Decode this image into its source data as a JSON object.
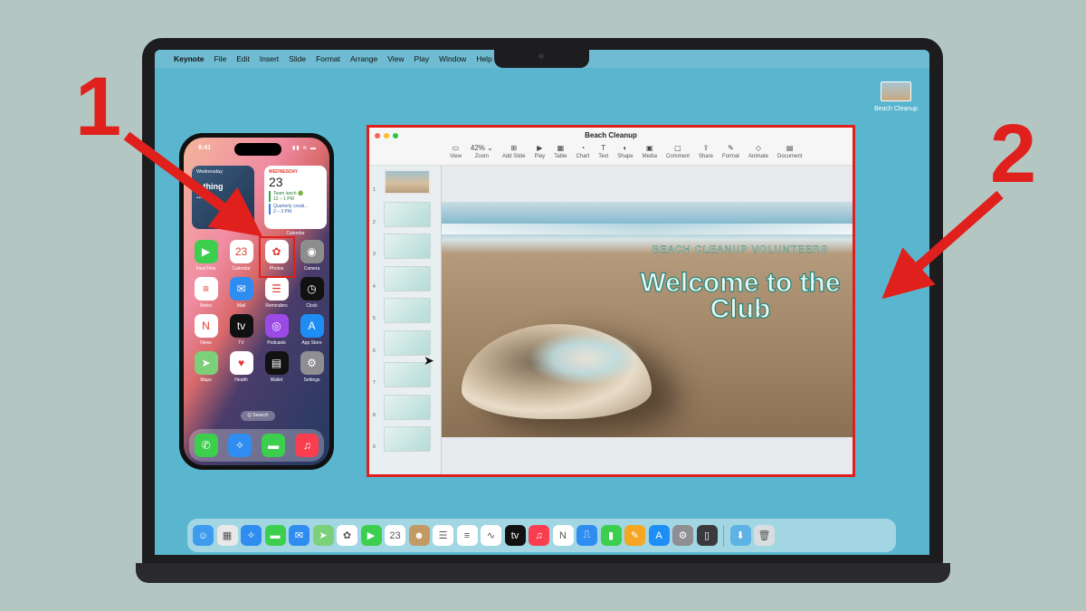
{
  "menubar": {
    "apple": "",
    "app_name": "Keynote",
    "items": [
      "File",
      "Edit",
      "Insert",
      "Slide",
      "Format",
      "Arrange",
      "View",
      "Play",
      "Window",
      "Help"
    ]
  },
  "desktop_file": {
    "label": "Beach Cleanup"
  },
  "iphone": {
    "time": "9:41",
    "status": "▮▮ ≋ ▬",
    "photo_widget": {
      "day": "Wednesday",
      "text": "...thing\n...t..."
    },
    "calendar_widget": {
      "month": "WEDNESDAY",
      "day": "23",
      "events": [
        {
          "title": "Team lunch 🟢",
          "time": "12 – 1 PM"
        },
        {
          "title": "Quarterly creati...",
          "time": "2 – 3 PM"
        }
      ],
      "label": "Calendar"
    },
    "apps": [
      {
        "label": "FaceTime",
        "icon": "facetime-icon",
        "color": "#3ccf4e",
        "glyph": "▶"
      },
      {
        "label": "Calendar",
        "icon": "calendar-icon",
        "color": "#ffffff",
        "glyph": "23"
      },
      {
        "label": "Photos",
        "icon": "photos-icon",
        "color": "#ffffff",
        "glyph": "✿"
      },
      {
        "label": "Camera",
        "icon": "camera-icon",
        "color": "#8d8d8d",
        "glyph": "◉"
      },
      {
        "label": "Notes",
        "icon": "notes-icon",
        "color": "#ffffff",
        "glyph": "≡"
      },
      {
        "label": "Mail",
        "icon": "mail-icon",
        "color": "#2f8cf0",
        "glyph": "✉"
      },
      {
        "label": "Reminders",
        "icon": "reminders-icon",
        "color": "#ffffff",
        "glyph": "☰"
      },
      {
        "label": "Clock",
        "icon": "clock-icon",
        "color": "#111111",
        "glyph": "◷"
      },
      {
        "label": "News",
        "icon": "news-icon",
        "color": "#ffffff",
        "glyph": "N"
      },
      {
        "label": "TV",
        "icon": "tv-icon",
        "color": "#111111",
        "glyph": "tv"
      },
      {
        "label": "Podcasts",
        "icon": "podcasts-icon",
        "color": "#9b4ae6",
        "glyph": "◎"
      },
      {
        "label": "App Store",
        "icon": "app-store-icon",
        "color": "#1e8ef5",
        "glyph": "A"
      },
      {
        "label": "Maps",
        "icon": "maps-icon",
        "color": "#7dd07a",
        "glyph": "➤"
      },
      {
        "label": "Health",
        "icon": "health-icon",
        "color": "#ffffff",
        "glyph": "♥"
      },
      {
        "label": "Wallet",
        "icon": "wallet-icon",
        "color": "#111111",
        "glyph": "▤"
      },
      {
        "label": "Settings",
        "icon": "settings-icon",
        "color": "#8e8e93",
        "glyph": "⚙"
      }
    ],
    "search": "Q Search",
    "dock": [
      {
        "icon": "phone-icon",
        "color": "#3ccf4e",
        "glyph": "✆"
      },
      {
        "icon": "safari-icon",
        "color": "#2f8cf0",
        "glyph": "✧"
      },
      {
        "icon": "messages-icon",
        "color": "#3ccf4e",
        "glyph": "▬"
      },
      {
        "icon": "music-icon",
        "color": "#fa3d4f",
        "glyph": "♫"
      }
    ]
  },
  "keynote": {
    "title": "Beach Cleanup",
    "toolbar": [
      {
        "label": "View",
        "icon": "view-icon",
        "glyph": "▭"
      },
      {
        "label": "Zoom",
        "icon": "zoom-icon",
        "glyph": "42% ⌄"
      },
      {
        "label": "Add Slide",
        "icon": "add-slide-icon",
        "glyph": "⊞"
      },
      {
        "label": "Play",
        "icon": "play-icon",
        "glyph": "▶"
      },
      {
        "label": "Table",
        "icon": "table-icon",
        "glyph": "▦"
      },
      {
        "label": "Chart",
        "icon": "chart-icon",
        "glyph": "◔"
      },
      {
        "label": "Text",
        "icon": "text-icon",
        "glyph": "T"
      },
      {
        "label": "Shape",
        "icon": "shape-icon",
        "glyph": "◐"
      },
      {
        "label": "Media",
        "icon": "media-icon",
        "glyph": "▣"
      },
      {
        "label": "Comment",
        "icon": "comment-icon",
        "glyph": "▢"
      },
      {
        "label": "Share",
        "icon": "share-icon",
        "glyph": "⇪"
      },
      {
        "label": "Format",
        "icon": "format-icon",
        "glyph": "✎"
      },
      {
        "label": "Animate",
        "icon": "animate-icon",
        "glyph": "◇"
      },
      {
        "label": "Document",
        "icon": "document-icon",
        "glyph": "▤"
      }
    ],
    "slide_numbers": [
      "1",
      "2",
      "3",
      "4",
      "5",
      "6",
      "7",
      "8",
      "9"
    ],
    "slide": {
      "kicker": "BEACH CLEANUP VOLUNTEERS",
      "title": "Welcome to the Club"
    }
  },
  "annotations": {
    "one": "1",
    "two": "2"
  },
  "colors": {
    "annotation_red": "#e0201c",
    "desktop": "#5ab6cf"
  },
  "mac_dock": [
    {
      "icon": "finder-icon",
      "color": "#3d9cf0",
      "glyph": "☺"
    },
    {
      "icon": "launchpad-icon",
      "color": "#e8e8e8",
      "glyph": "▦"
    },
    {
      "icon": "safari-icon",
      "color": "#2f8cf0",
      "glyph": "✧"
    },
    {
      "icon": "messages-icon",
      "color": "#3ccf4e",
      "glyph": "▬"
    },
    {
      "icon": "mail-icon",
      "color": "#2f8cf0",
      "glyph": "✉"
    },
    {
      "icon": "maps-icon",
      "color": "#7dd07a",
      "glyph": "➤"
    },
    {
      "icon": "photos-icon",
      "color": "#ffffff",
      "glyph": "✿"
    },
    {
      "icon": "facetime-icon",
      "color": "#3ccf4e",
      "glyph": "▶"
    },
    {
      "icon": "calendar-icon",
      "color": "#ffffff",
      "glyph": "23"
    },
    {
      "icon": "contacts-icon",
      "color": "#c29a64",
      "glyph": "☻"
    },
    {
      "icon": "reminders-icon",
      "color": "#ffffff",
      "glyph": "☰"
    },
    {
      "icon": "notes-icon",
      "color": "#ffffff",
      "glyph": "≡"
    },
    {
      "icon": "freeform-icon",
      "color": "#ffffff",
      "glyph": "∿"
    },
    {
      "icon": "tv-icon",
      "color": "#111111",
      "glyph": "tv"
    },
    {
      "icon": "music-icon",
      "color": "#fa3d4f",
      "glyph": "♫"
    },
    {
      "icon": "news-icon",
      "color": "#ffffff",
      "glyph": "N"
    },
    {
      "icon": "keynote-icon",
      "color": "#2f8cf0",
      "glyph": "⎍"
    },
    {
      "icon": "numbers-icon",
      "color": "#3ccf4e",
      "glyph": "▮"
    },
    {
      "icon": "pages-icon",
      "color": "#f5a623",
      "glyph": "✎"
    },
    {
      "icon": "app-store-icon",
      "color": "#1e8ef5",
      "glyph": "A"
    },
    {
      "icon": "system-settings-icon",
      "color": "#8e8e93",
      "glyph": "⚙"
    },
    {
      "icon": "iphone-mirroring-icon",
      "color": "#3a3a3c",
      "glyph": "▯"
    }
  ],
  "mac_dock_right": [
    {
      "icon": "downloads-folder-icon",
      "color": "#5eb3e6",
      "glyph": "⬇"
    },
    {
      "icon": "trash-icon",
      "color": "#d8dde0",
      "glyph": "🗑"
    }
  ]
}
